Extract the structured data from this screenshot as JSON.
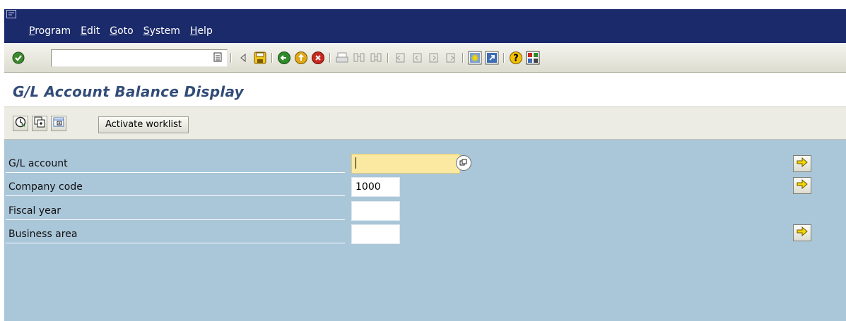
{
  "menu": {
    "items": [
      "Program",
      "Edit",
      "Goto",
      "System",
      "Help"
    ]
  },
  "toolbar": {
    "command_field_value": "",
    "buttons": [
      "enter-icon",
      "command-history-icon",
      "back-nav-icon",
      "save-icon",
      "back-icon",
      "exit-icon",
      "cancel-icon",
      "print-icon",
      "find-icon",
      "find-next-icon",
      "first-page-icon",
      "previous-page-icon",
      "next-page-icon",
      "last-page-icon",
      "create-session-icon",
      "shortcut-icon",
      "help-icon",
      "layout-menu-icon"
    ]
  },
  "page": {
    "title": "G/L Account Balance Display"
  },
  "app_toolbar": {
    "activate_worklist_label": "Activate worklist",
    "icons": [
      "execute-icon",
      "get-variant-icon",
      "selection-options-icon"
    ]
  },
  "form": {
    "fields": [
      {
        "label": "G/L account",
        "value": ""
      },
      {
        "label": "Company code",
        "value": "1000"
      },
      {
        "label": "Fiscal year",
        "value": ""
      },
      {
        "label": "Business area",
        "value": ""
      }
    ]
  },
  "colors": {
    "menubar": "#1b2a6b",
    "title": "#324c78",
    "form_background": "#aac6d9",
    "focused_field": "#fbe9a2"
  }
}
